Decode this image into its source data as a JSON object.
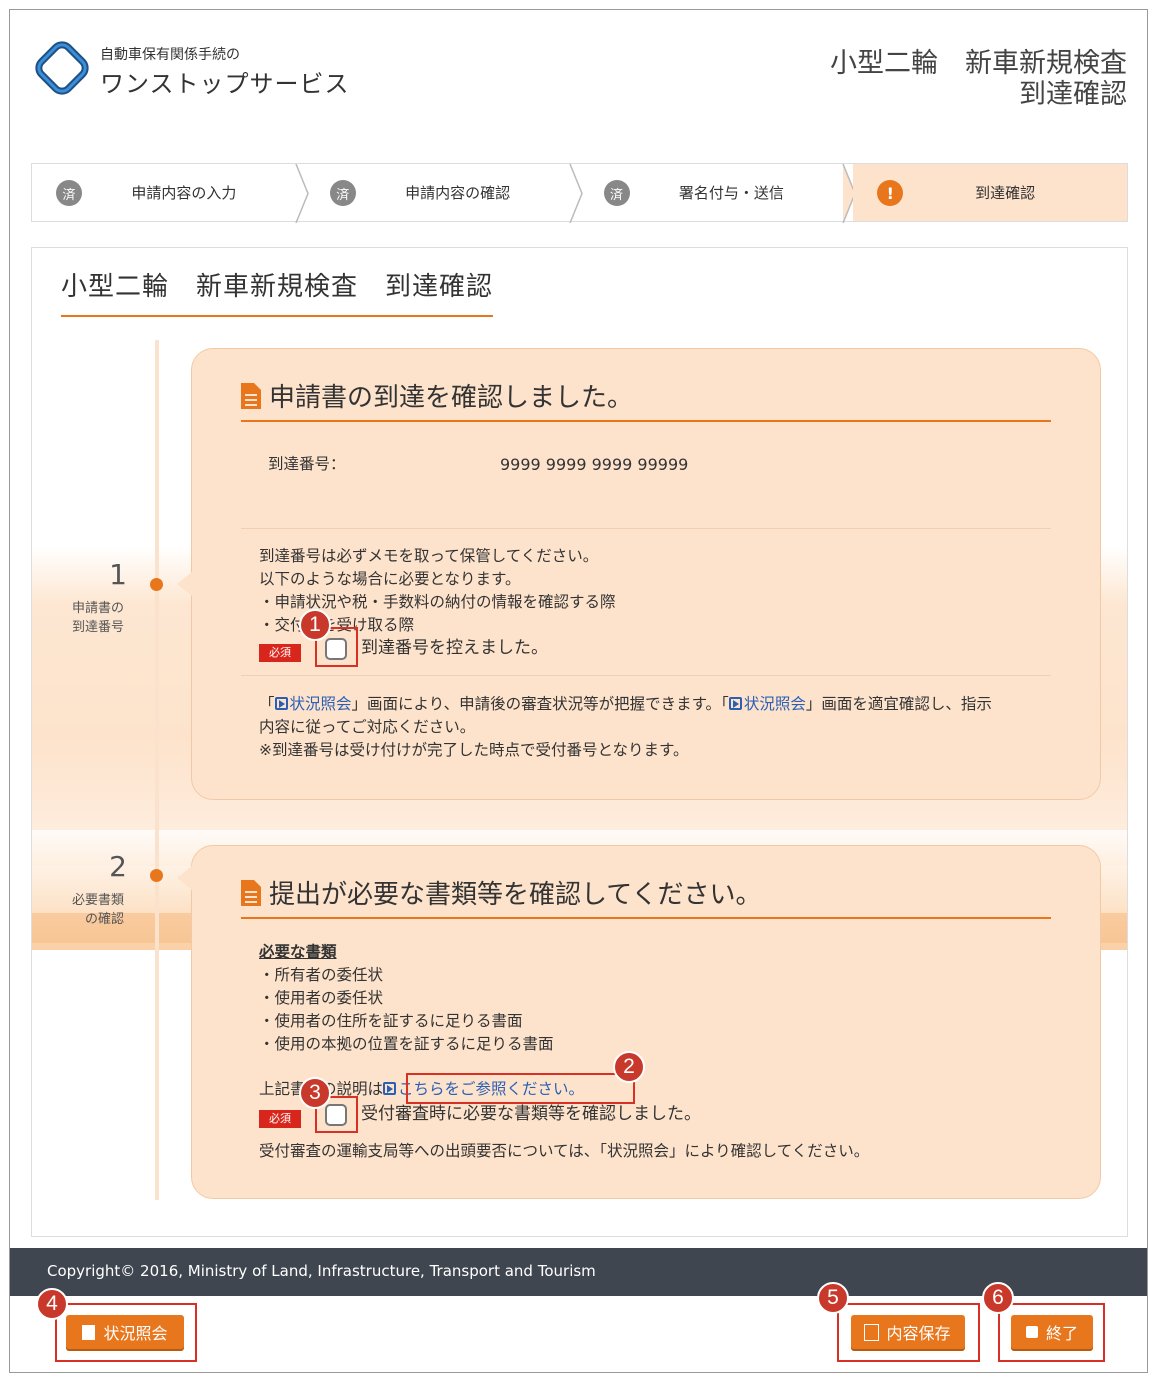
{
  "header": {
    "brand_sub": "自動車保有関係手続の",
    "brand_main": "ワンストップサービス",
    "title_line1": "小型二輪　新車新規検査",
    "title_line2": "到達確認"
  },
  "steps": [
    {
      "badge": "済",
      "label": "申請内容の入力"
    },
    {
      "badge": "済",
      "label": "申請内容の確認"
    },
    {
      "badge": "済",
      "label": "署名付与・送信"
    },
    {
      "badge": "!",
      "label": "到達確認"
    }
  ],
  "page_title": "小型二輪　新車新規検査　到達確認",
  "section1": {
    "num": "1",
    "caption1": "申請書の",
    "caption2": "到達番号",
    "card_title": "申請書の到達を確認しました。",
    "arrival_label": "到達番号：",
    "arrival_value": "9999 9999 9999 99999",
    "note1": "到達番号は必ずメモを取って保管してください。",
    "note2": "以下のような場合に必要となります。",
    "note3": "・申請状況や税・手数料の納付の情報を確認する際",
    "note4": "・交付物を受け取る際",
    "required": "必須",
    "check_label": "到達番号を控えました。",
    "info_a": "「",
    "info_link1": "状況照会",
    "info_b": "」画面により、申請後の審査状況等が把握できます。「",
    "info_link2": "状況照会",
    "info_c": "」画面を適宜確認し、指示",
    "info2": "内容に従ってご対応ください。",
    "info3": "※到達番号は受け付けが完了した時点で受付番号となります。"
  },
  "section2": {
    "num": "2",
    "caption1": "必要書類",
    "caption2": "の確認",
    "card_title": "提出が必要な書類等を確認してください。",
    "docs_heading": "必要な書類",
    "docs": [
      "・所有者の委任状",
      "・使用者の委任状",
      "・使用者の住所を証するに足りる書面",
      "・使用の本拠の位置を証するに足りる書面"
    ],
    "explain_prefix": "上記書類の説明は",
    "explain_link": "こちらをご参照ください。",
    "required": "必須",
    "check_label": "受付審査時に必要な書類等を確認しました。",
    "footer_note": "受付審査の運輸支局等への出頭要否については、「状況照会」により確認してください。"
  },
  "annotations": [
    "1",
    "2",
    "3",
    "4",
    "5",
    "6"
  ],
  "footer": {
    "copyright": "Copyright© 2016, Ministry of Land, Infrastructure, Transport and Tourism"
  },
  "buttons": {
    "status": "状況照会",
    "save": "内容保存",
    "exit": "終了"
  },
  "colors": {
    "accent": "#e8761c",
    "card_bg": "#fde3cc",
    "required_bg": "#d9261c",
    "footer_bg": "#3f4650",
    "link": "#2b5fb4"
  }
}
